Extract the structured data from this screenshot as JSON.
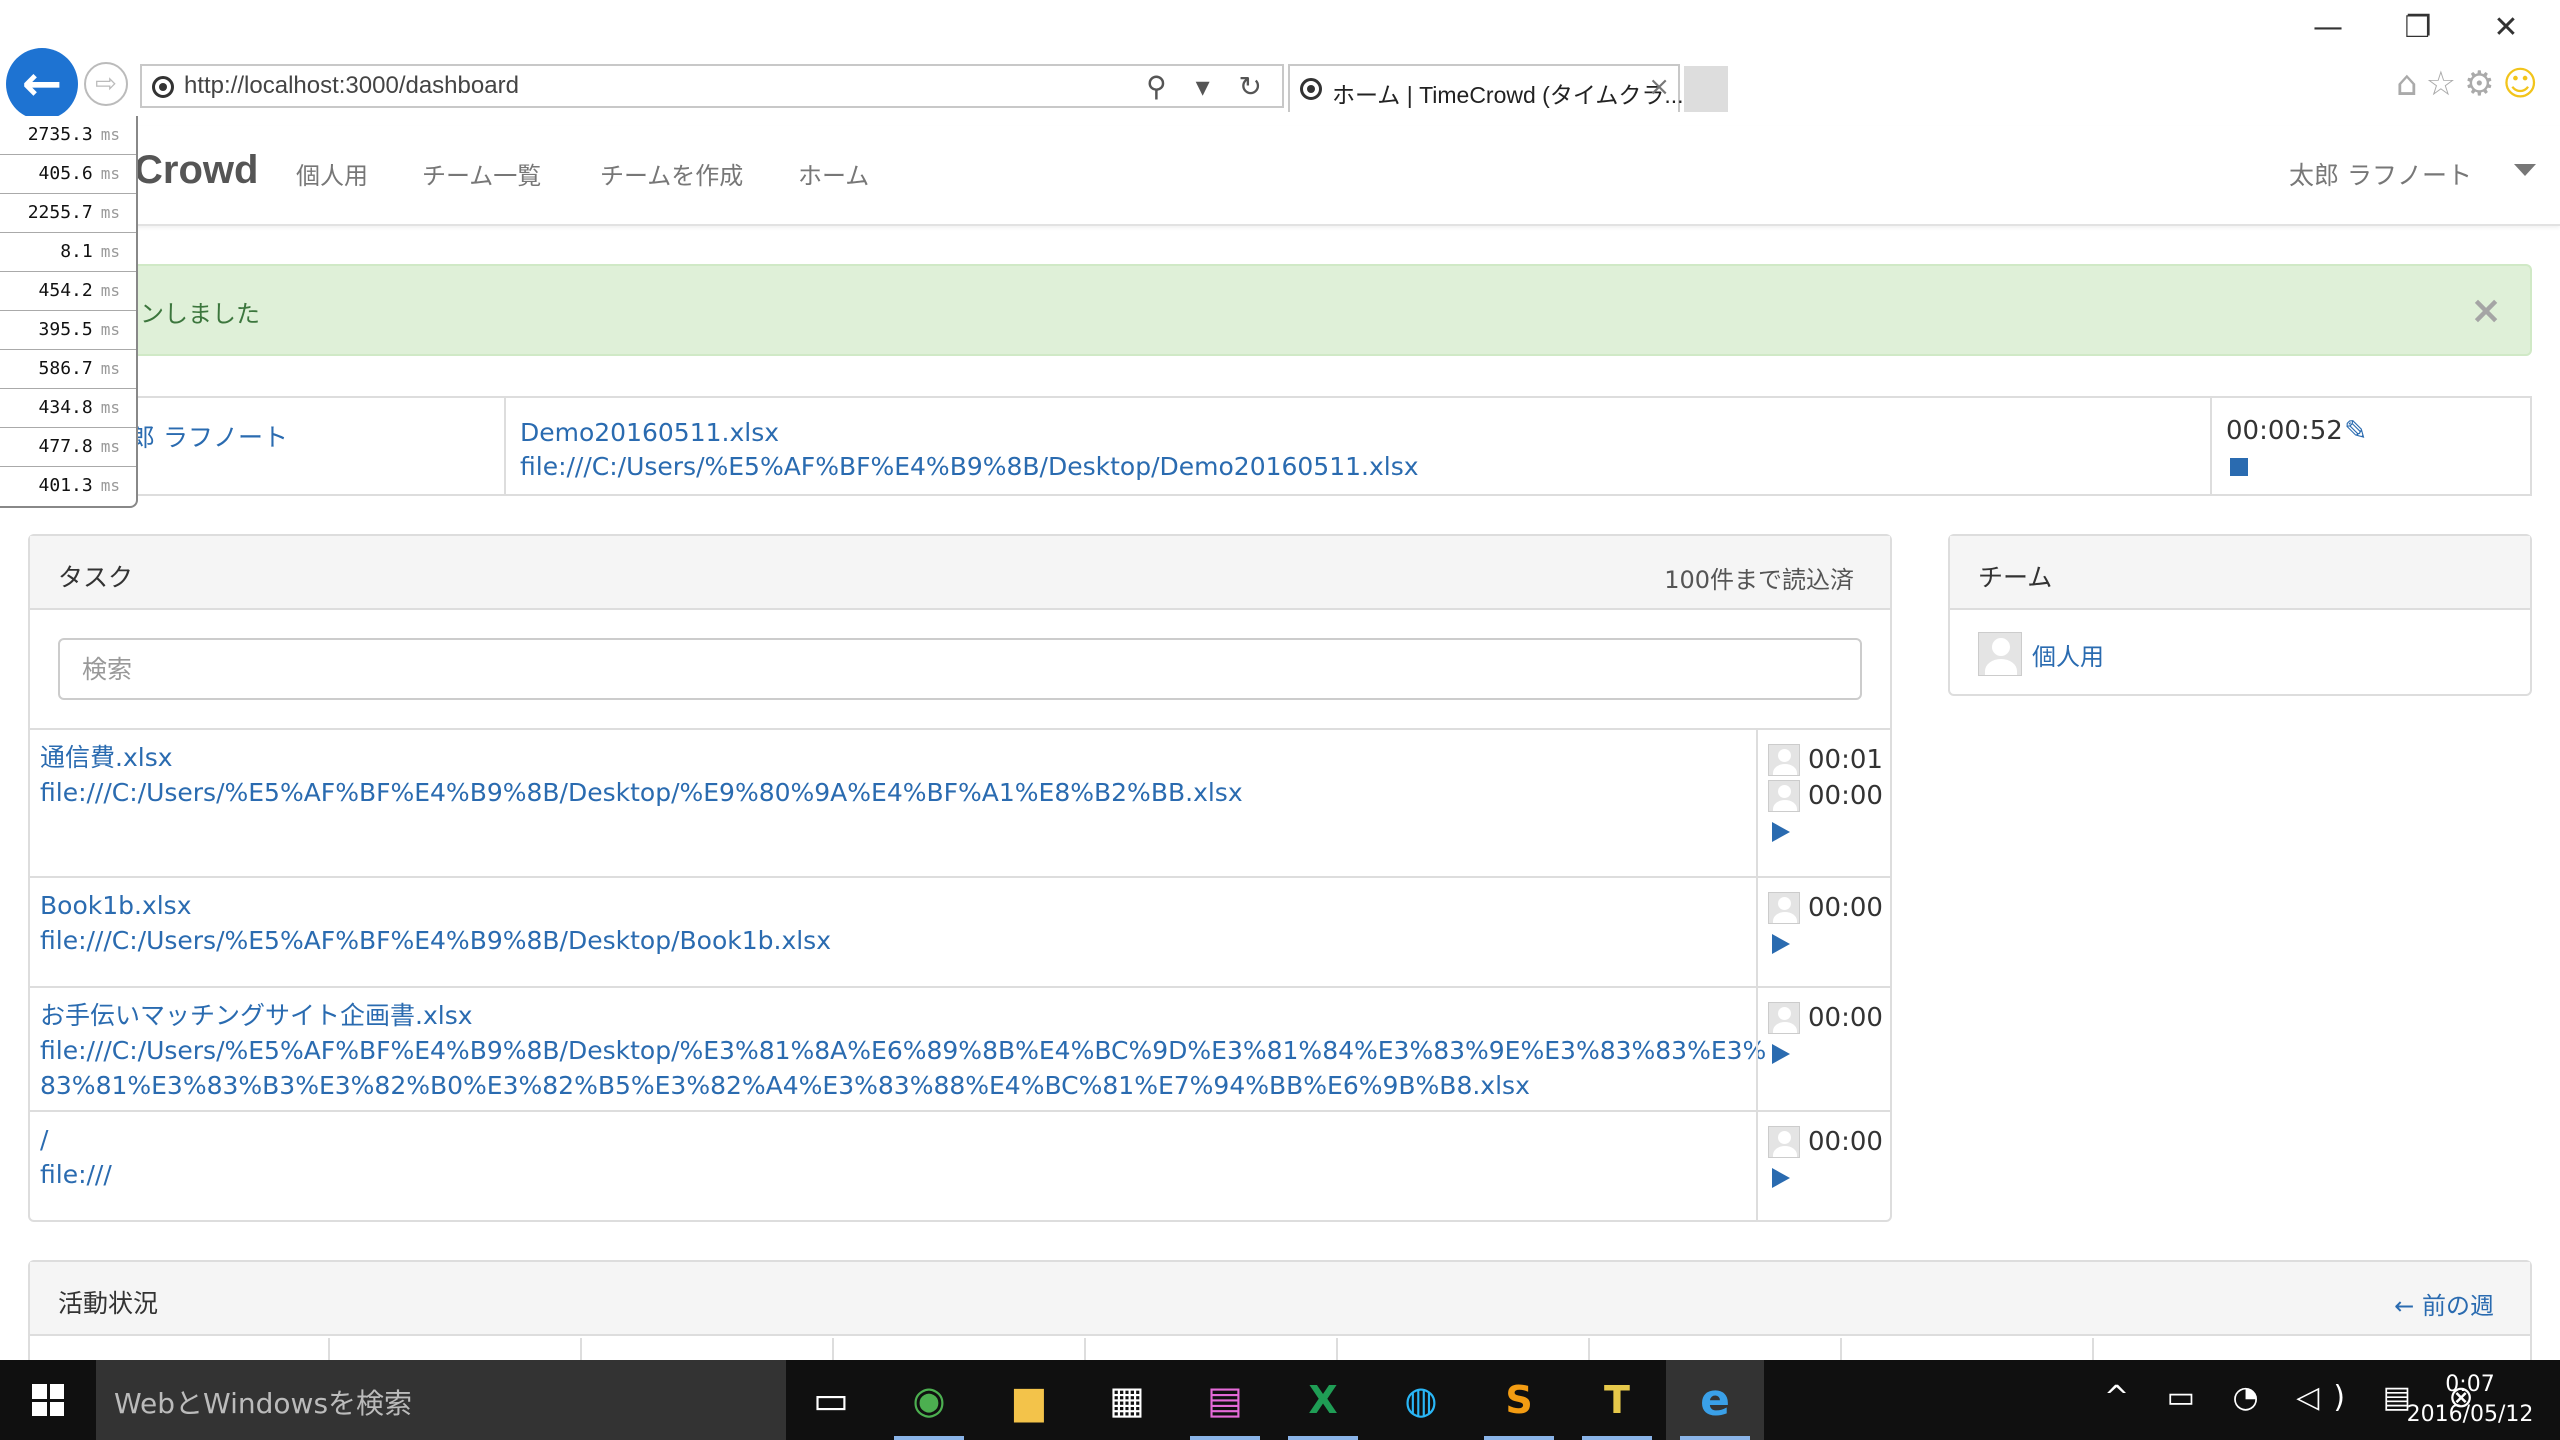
{
  "browser": {
    "url": "http://localhost:3000/dashboard",
    "tab_title": "ホーム | TimeCrowd (タイムクラ...",
    "tab_close": "×",
    "back_glyph": "←",
    "forward_glyph": "⇨",
    "address_icons": "⚲ ▾ ↻",
    "window_min": "—",
    "window_restore": "❐",
    "window_close": "✕",
    "right_icons": [
      "home-icon",
      "star-icon",
      "gear-icon",
      "smiley-icon"
    ]
  },
  "profiler": {
    "unit": "ms",
    "timings": [
      "2735.3",
      "405.6",
      "2255.7",
      "8.1",
      "454.2",
      "395.5",
      "586.7",
      "434.8",
      "477.8",
      "401.3"
    ]
  },
  "navbar": {
    "brand": "Crowd",
    "items": [
      "個人用",
      "チーム一覧",
      "チームを作成",
      "ホーム"
    ],
    "user": "太郎 ラフノート"
  },
  "alert": {
    "text": "ンしました",
    "close": "×"
  },
  "current": {
    "user": "郎 ラフノート",
    "file_name": "Demo20160511.xlsx",
    "file_url": "file:///C:/Users/%E5%AF%BF%E4%B9%8B/Desktop/Demo20160511.xlsx",
    "elapsed": "00:00:52",
    "edit_icon": "✎"
  },
  "tasks": {
    "title": "タスク",
    "loaded": "100件まで読込済",
    "search_placeholder": "検索",
    "rows": [
      {
        "name": "通信費.xlsx",
        "url": "file:///C:/Users/%E5%AF%BF%E4%B9%8B/Desktop/%E9%80%9A%E4%BF%A1%E8%B2%BB.xlsx",
        "times": [
          "00:01",
          "00:00"
        ]
      },
      {
        "name": "Book1b.xlsx",
        "url": "file:///C:/Users/%E5%AF%BF%E4%B9%8B/Desktop/Book1b.xlsx",
        "times": [
          "00:00"
        ]
      },
      {
        "name": "お手伝いマッチングサイト企画書.xlsx",
        "url": "file:///C:/Users/%E5%AF%BF%E4%B9%8B/Desktop/%E3%81%8A%E6%89%8B%E4%BC%9D%E3%81%84%E3%83%9E%E3%83%83%E3%83%81%E3%83%B3%E3%82%B0%E3%82%B5%E3%82%A4%E3%83%88%E4%BC%81%E7%94%BB%E6%9B%B8.xlsx",
        "times": [
          "00:00"
        ]
      },
      {
        "name": "/",
        "url": "file:///",
        "times": [
          "00:00"
        ]
      }
    ]
  },
  "team": {
    "title": "チーム",
    "item": "個人用"
  },
  "activity": {
    "title": "活動状況",
    "prev_week": "← 前の週"
  },
  "taskbar": {
    "search_text": "WebとWindowsを検索",
    "apps": [
      {
        "name": "task-view-icon",
        "glyph": "▭"
      },
      {
        "name": "chrome-icon",
        "glyph": "◉"
      },
      {
        "name": "file-explorer-icon",
        "glyph": "▆"
      },
      {
        "name": "store-icon",
        "glyph": "▦"
      },
      {
        "name": "paint-icon",
        "glyph": "▤"
      },
      {
        "name": "excel-icon",
        "glyph": "X"
      },
      {
        "name": "docker-icon",
        "glyph": "◍"
      },
      {
        "name": "sublime-icon",
        "glyph": "S"
      },
      {
        "name": "notepad-icon",
        "glyph": "T"
      },
      {
        "name": "ie-icon",
        "glyph": "e"
      }
    ],
    "tray": "^ ▭ ◔ ◁) ▤ ⊗",
    "time": "0:07",
    "date": "2016/05/12"
  }
}
